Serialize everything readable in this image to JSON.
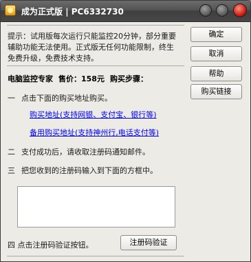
{
  "window": {
    "title": "成为正式版",
    "machine_code": "PC6332730"
  },
  "tip": "提示：试用版每次运行只能监控20分钟，部分重要辅助功能无法使用。正式版无任何功能限制，终生免费升级，免费技术支持。",
  "header": {
    "product": "电脑监控专家",
    "price_label": "售价：158元",
    "steps_label": "购买步骤："
  },
  "steps": {
    "s1": {
      "num": "一",
      "text": "点击下面的购买地址购买。"
    },
    "link1": "购买地址(支持网银、支付宝、银行等)",
    "link2": "备用购买地址(支持神州行,电话支付等)",
    "s2": {
      "num": "二",
      "text": "支付成功后，请收取注册码通知邮件。"
    },
    "s3": {
      "num": "三",
      "text": "把您收到的注册码输入到下面的方框中。"
    },
    "s4": {
      "text": "四 点击注册码验证按钮。"
    }
  },
  "regcode": {
    "value": "",
    "placeholder": ""
  },
  "buttons": {
    "ok": "确定",
    "cancel": "取消",
    "help": "帮助",
    "buy_link": "购买链接",
    "verify": "注册码验证"
  }
}
